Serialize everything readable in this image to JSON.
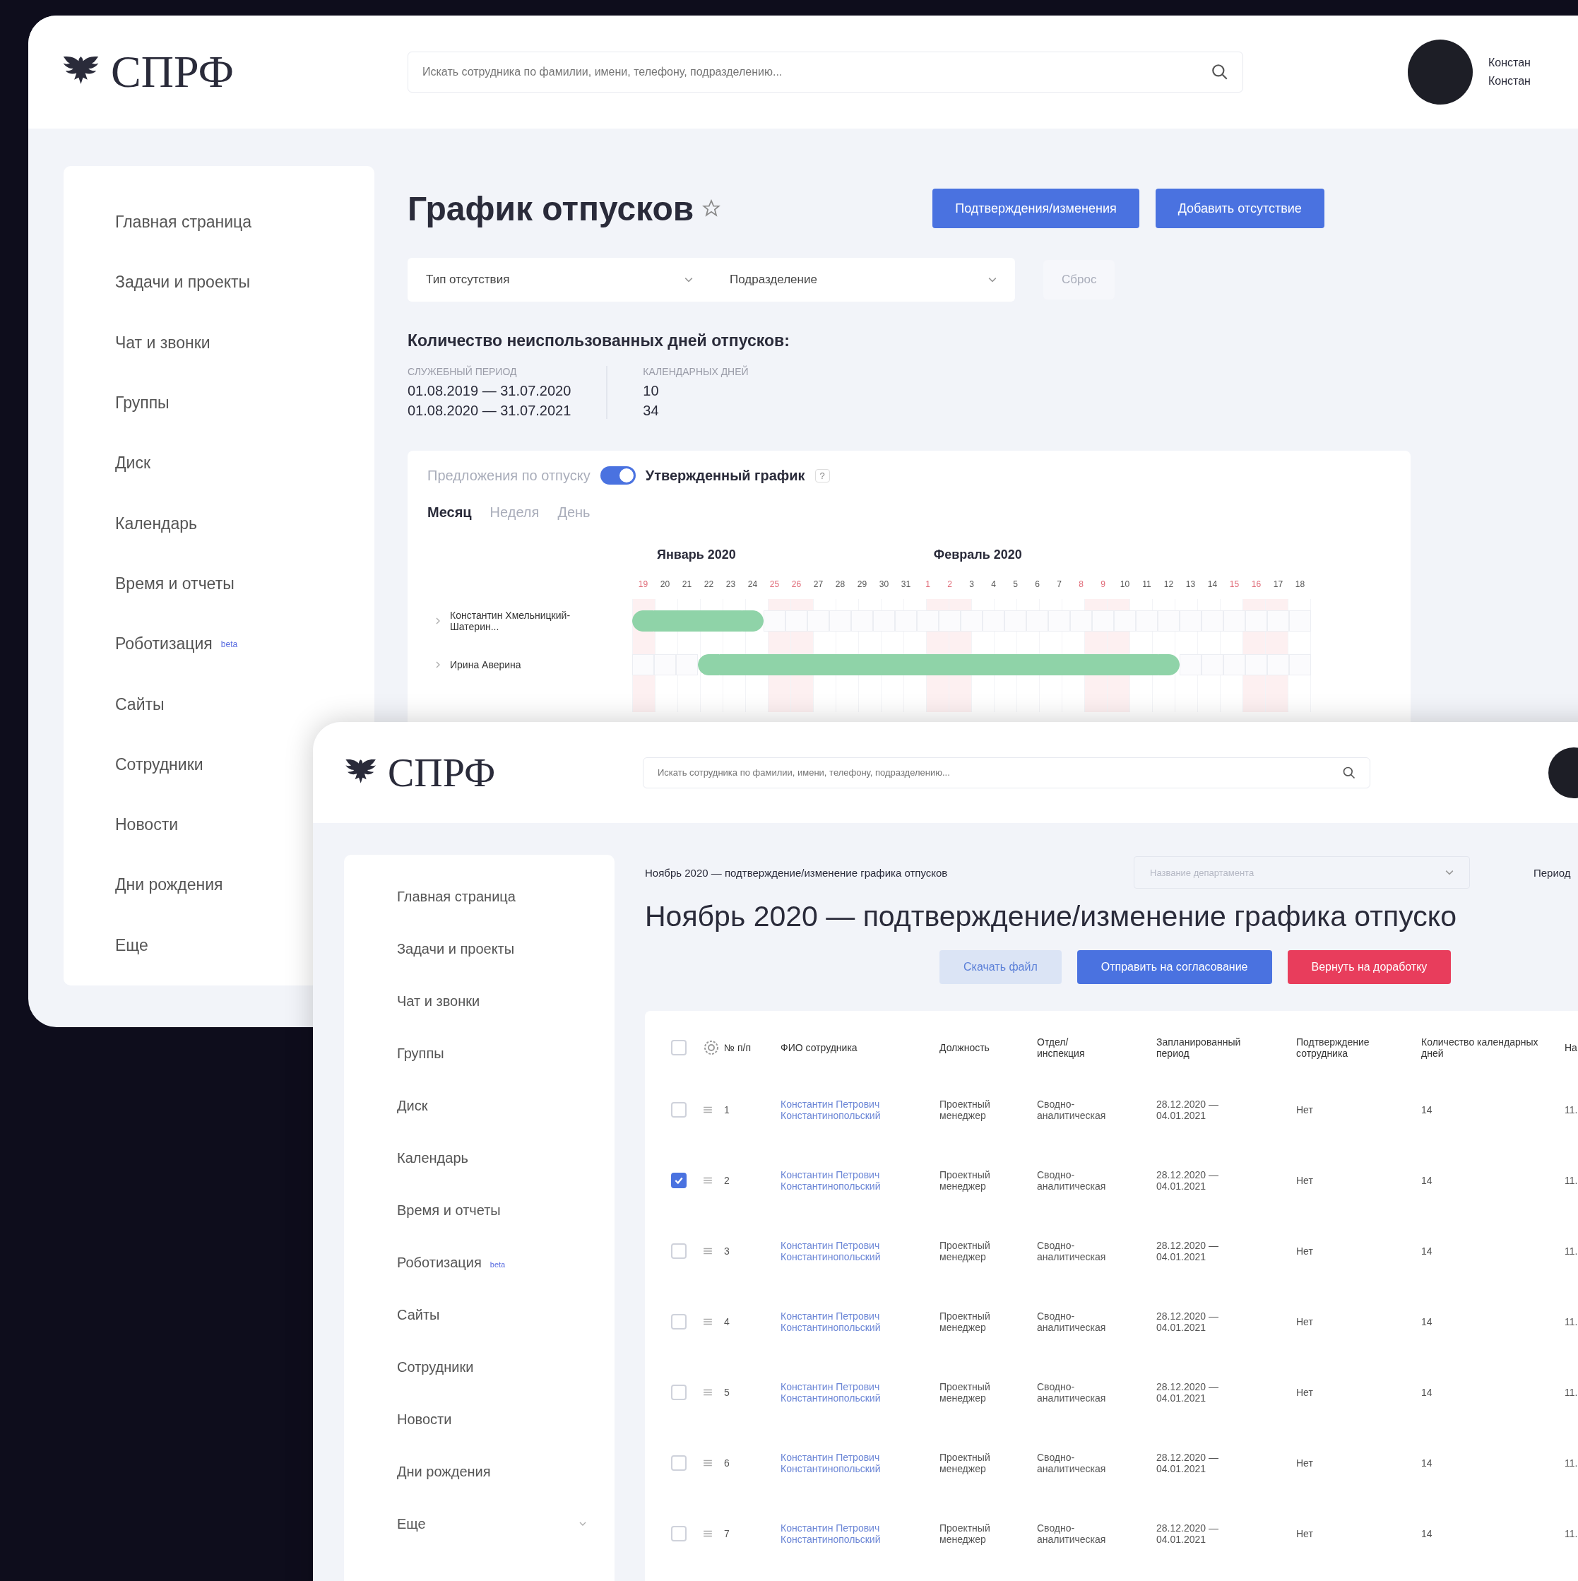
{
  "top_window": {
    "logo": "СПРФ",
    "search": {
      "placeholder": "Искать сотрудника по фамилии, имени, телефону, подразделению..."
    },
    "user": {
      "name_lines": [
        "Констан",
        "Констан"
      ]
    },
    "sidebar": {
      "items": [
        {
          "label": "Главная страница"
        },
        {
          "label": "Задачи и проекты"
        },
        {
          "label": "Чат и звонки"
        },
        {
          "label": "Группы"
        },
        {
          "label": "Диск"
        },
        {
          "label": "Календарь"
        },
        {
          "label": "Время и отчеты"
        },
        {
          "label": "Роботизация",
          "badge": "beta"
        },
        {
          "label": "Сайты"
        },
        {
          "label": "Сотрудники"
        },
        {
          "label": "Новости"
        },
        {
          "label": "Дни рождения"
        },
        {
          "label": "Еще"
        }
      ]
    },
    "title": "График отпусков",
    "favorite": false,
    "buttons": [
      {
        "label": "Подтверждения/изменения"
      },
      {
        "label": "Добавить отсутствие"
      }
    ],
    "filters": [
      {
        "placeholder": "Тип отсутствия"
      },
      {
        "placeholder": "Подразделение"
      }
    ],
    "reset_button": {
      "label": "Сброс",
      "disabled": true
    },
    "unused_days": {
      "heading": "Количество неиспользованных дней отпусков:",
      "columns": [
        {
          "header": "СЛУЖЕБНЫЙ ПЕРИОД",
          "values": [
            "01.08.2019 — 31.07.2020",
            "01.08.2020 — 31.07.2021"
          ]
        },
        {
          "header": "КАЛЕНДАРНЫХ ДНЕЙ",
          "values": [
            "10",
            "34"
          ]
        }
      ]
    },
    "schedule": {
      "toggle": {
        "left_label": "Предложения по отпуску",
        "right_label": "Утвержденный график",
        "on": true
      },
      "help": "?",
      "tabs": [
        {
          "label": "Месяц",
          "selected": true
        },
        {
          "label": "Неделя",
          "selected": false
        },
        {
          "label": "День",
          "selected": false
        }
      ],
      "months": [
        "Январь 2020",
        "Февраль 2020"
      ],
      "days": [
        {
          "label": "19",
          "weekend": true
        },
        {
          "label": "20",
          "weekend": false
        },
        {
          "label": "21",
          "weekend": false
        },
        {
          "label": "22",
          "weekend": false
        },
        {
          "label": "23",
          "weekend": false
        },
        {
          "label": "24",
          "weekend": false
        },
        {
          "label": "25",
          "weekend": true
        },
        {
          "label": "26",
          "weekend": true
        },
        {
          "label": "27",
          "weekend": false
        },
        {
          "label": "28",
          "weekend": false
        },
        {
          "label": "29",
          "weekend": false
        },
        {
          "label": "30",
          "weekend": false
        },
        {
          "label": "31",
          "weekend": false
        },
        {
          "label": "1",
          "weekend": true
        },
        {
          "label": "2",
          "weekend": true
        },
        {
          "label": "3",
          "weekend": false
        },
        {
          "label": "4",
          "weekend": false
        },
        {
          "label": "5",
          "weekend": false
        },
        {
          "label": "6",
          "weekend": false
        },
        {
          "label": "7",
          "weekend": false
        },
        {
          "label": "8",
          "weekend": true
        },
        {
          "label": "9",
          "weekend": true
        },
        {
          "label": "10",
          "weekend": false
        },
        {
          "label": "11",
          "weekend": false
        },
        {
          "label": "12",
          "weekend": false
        },
        {
          "label": "13",
          "weekend": false
        },
        {
          "label": "14",
          "weekend": false
        },
        {
          "label": "15",
          "weekend": true
        },
        {
          "label": "16",
          "weekend": true
        },
        {
          "label": "17",
          "weekend": false
        },
        {
          "label": "18",
          "weekend": false
        }
      ],
      "rows": [
        {
          "name": "Константин Хмельницкий-Шатерин...",
          "vacation": [
            true,
            true,
            true,
            true,
            true,
            true,
            false,
            false,
            false,
            false,
            false,
            false,
            false,
            false,
            false,
            false,
            false,
            false,
            false,
            false,
            false,
            false,
            false,
            false,
            false,
            false,
            false,
            false,
            false,
            false,
            false
          ]
        },
        {
          "name": "Ирина Аверина",
          "vacation": [
            false,
            false,
            false,
            true,
            true,
            true,
            true,
            true,
            true,
            true,
            true,
            true,
            true,
            true,
            true,
            true,
            true,
            true,
            true,
            true,
            true,
            true,
            true,
            true,
            true,
            false,
            false,
            false,
            false,
            false,
            false
          ]
        }
      ]
    }
  },
  "bottom_window": {
    "logo": "СПРФ",
    "search": {
      "placeholder": "Искать сотрудника по фамилии, имени, телефону, подразделению..."
    },
    "sidebar": {
      "items": [
        {
          "label": "Главная страница"
        },
        {
          "label": "Задачи и проекты"
        },
        {
          "label": "Чат и звонки"
        },
        {
          "label": "Группы"
        },
        {
          "label": "Диск"
        },
        {
          "label": "Календарь"
        },
        {
          "label": "Время и отчеты"
        },
        {
          "label": "Роботизация",
          "badge": "beta"
        },
        {
          "label": "Сайты"
        },
        {
          "label": "Сотрудники"
        },
        {
          "label": "Новости"
        },
        {
          "label": "Дни рождения"
        },
        {
          "label": "Еще",
          "expandable": true
        }
      ]
    },
    "breadcrumb": "Ноябрь 2020 — подтверждение/изменение графика отпусков",
    "department": {
      "placeholder": "Название департамента"
    },
    "period_label": "Период",
    "title": "Ноябрь 2020 — подтверждение/изменение графика отпуско",
    "buttons": [
      {
        "label": "Скачать файл",
        "kind": "light"
      },
      {
        "label": "Отправить на согласование",
        "kind": "primary"
      },
      {
        "label": "Вернуть на доработку",
        "kind": "danger"
      }
    ],
    "table": {
      "all_checked": false,
      "columns": [
        "№ п/п",
        "ФИО сотрудника",
        "Должность",
        "Отдел/ инспекция",
        "Запланированный период",
        "Подтверждение сотрудника",
        "Количество календарных дней",
        "На"
      ],
      "rows": [
        {
          "checked": false,
          "number": "1",
          "employee": "Константин Петрович Константинопольский",
          "position": "Проектный менеджер",
          "department": "Сводно-аналитическая",
          "period": "28.12.2020 — 04.01.2021",
          "confirmation": "Нет",
          "days": "14",
          "column_9": "11."
        },
        {
          "checked": true,
          "number": "2",
          "employee": "Константин Петрович Константинопольский",
          "position": "Проектный менеджер",
          "department": "Сводно-аналитическая",
          "period": "28.12.2020 — 04.01.2021",
          "confirmation": "Нет",
          "days": "14",
          "column_9": "11."
        },
        {
          "checked": false,
          "number": "3",
          "employee": "Константин Петрович Константинопольский",
          "position": "Проектный менеджер",
          "department": "Сводно-аналитическая",
          "period": "28.12.2020 — 04.01.2021",
          "confirmation": "Нет",
          "days": "14",
          "column_9": "11."
        },
        {
          "checked": false,
          "number": "4",
          "employee": "Константин Петрович Константинопольский",
          "position": "Проектный менеджер",
          "department": "Сводно-аналитическая",
          "period": "28.12.2020 — 04.01.2021",
          "confirmation": "Нет",
          "days": "14",
          "column_9": "11."
        },
        {
          "checked": false,
          "number": "5",
          "employee": "Константин Петрович Константинопольский",
          "position": "Проектный менеджер",
          "department": "Сводно-аналитическая",
          "period": "28.12.2020 — 04.01.2021",
          "confirmation": "Нет",
          "days": "14",
          "column_9": "11."
        },
        {
          "checked": false,
          "number": "6",
          "employee": "Константин Петрович Константинопольский",
          "position": "Проектный менеджер",
          "department": "Сводно-аналитическая",
          "period": "28.12.2020 — 04.01.2021",
          "confirmation": "Нет",
          "days": "14",
          "column_9": "11."
        },
        {
          "checked": false,
          "number": "7",
          "employee": "Константин Петрович Константинопольский",
          "position": "Проектный менеджер",
          "department": "Сводно-аналитическая",
          "period": "28.12.2020 — 04.01.2021",
          "confirmation": "Нет",
          "days": "14",
          "column_9": "11."
        }
      ]
    }
  }
}
